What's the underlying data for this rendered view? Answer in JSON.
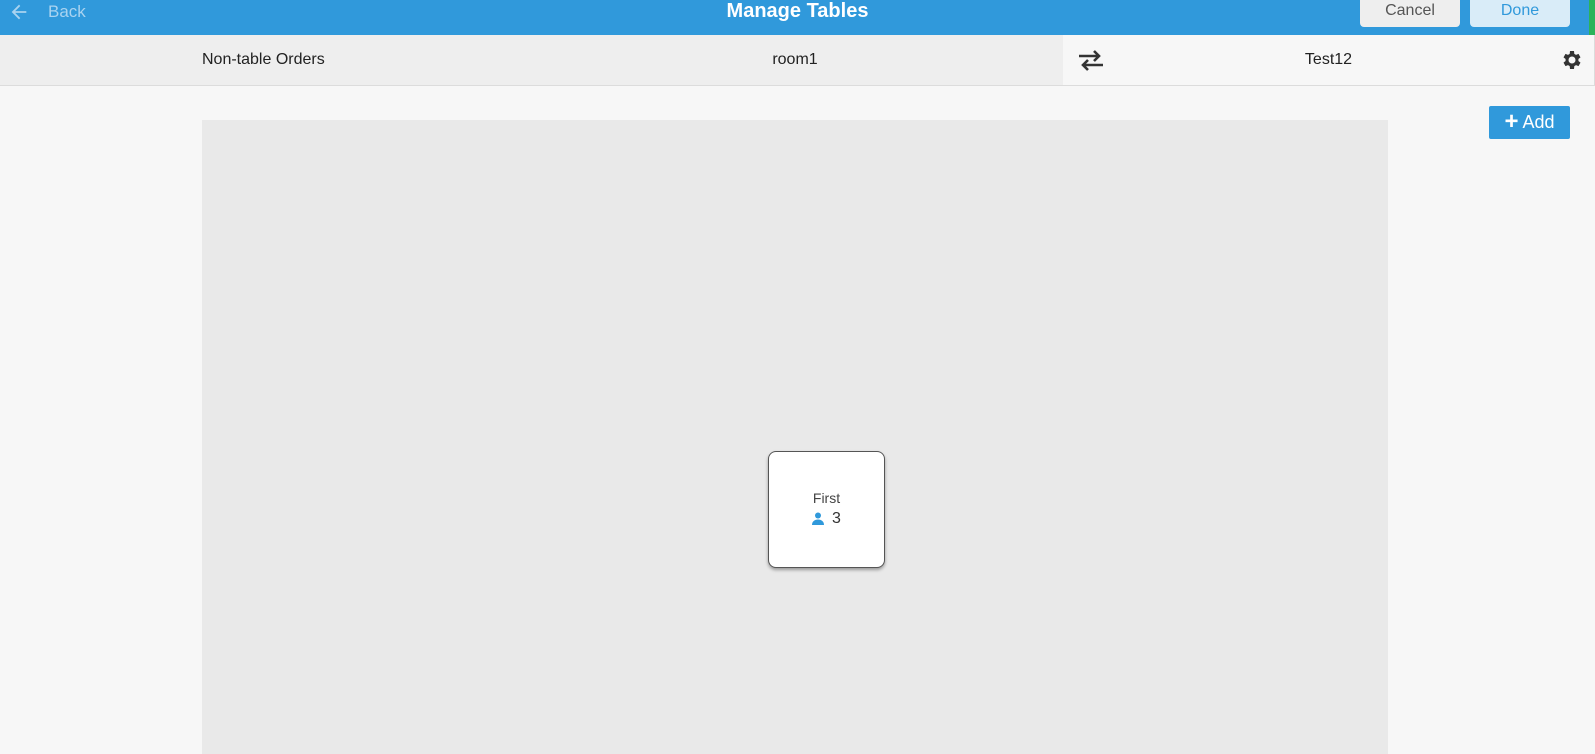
{
  "header": {
    "back_label": "Back",
    "title": "Manage Tables",
    "cancel_label": "Cancel",
    "done_label": "Done"
  },
  "tabs": {
    "non_table": "Non-table Orders",
    "room": "room1",
    "active": "Test12"
  },
  "toolbar": {
    "add_label": "Add"
  },
  "tables": [
    {
      "name": "First",
      "seats": "3"
    }
  ],
  "icons": {
    "back": "arrow-left-icon",
    "swap": "swap-arrows-icon",
    "settings": "gear-icon",
    "add": "plus-icon",
    "seats": "person-icon"
  },
  "colors": {
    "primary": "#3099db",
    "header_text": "#ffffff",
    "accent_edge": "#2bb35a"
  }
}
